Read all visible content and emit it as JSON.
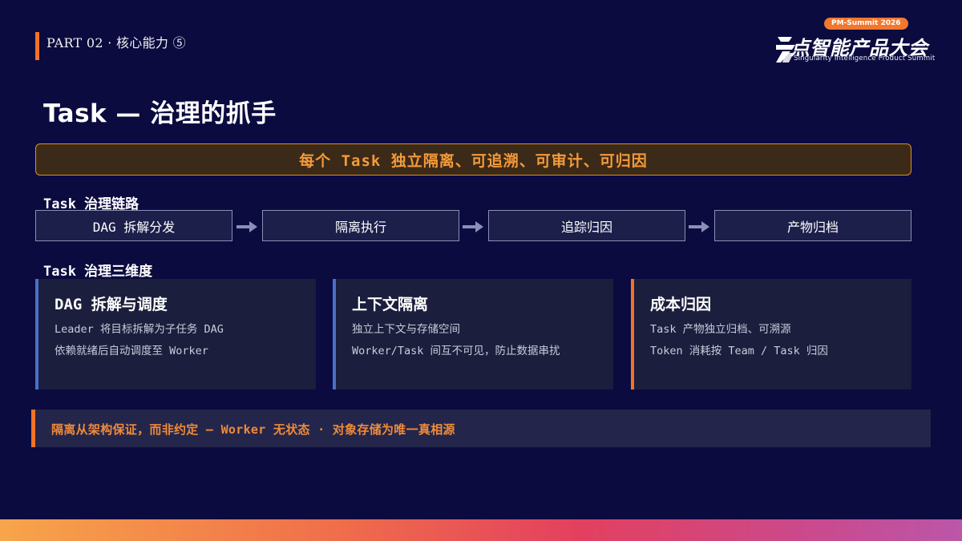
{
  "header": {
    "part_label": "PART 02 · 核心能力 ⑤"
  },
  "logo": {
    "badge": "PM-Summit 2026",
    "title": "点智能产品大会",
    "subtitle": "Singularity Intelligence Product Summit"
  },
  "title": "Task — 治理的抓手",
  "banner": "每个 Task 独立隔离、可追溯、可审计、可归因",
  "chain": {
    "label": "Task 治理链路",
    "steps": [
      "DAG 拆解分发",
      "隔离执行",
      "追踪归因",
      "产物归档"
    ]
  },
  "dimensions": {
    "label": "Task 治理三维度",
    "cards": [
      {
        "title": "DAG 拆解与调度",
        "lines": [
          "Leader 将目标拆解为子任务 DAG",
          "依赖就绪后自动调度至 Worker"
        ],
        "accent": "#4a6fc9"
      },
      {
        "title": "上下文隔离",
        "lines": [
          "独立上下文与存储空间",
          "Worker/Task 间互不可见，防止数据串扰"
        ],
        "accent": "#4a6fc9"
      },
      {
        "title": "成本归因",
        "lines": [
          "Task 产物独立归档、可溯源",
          "Token 消耗按 Team / Task 归因"
        ],
        "accent": "#f27226"
      }
    ]
  },
  "note": "隔离从架构保证，而非约定 — Worker 无状态 · 对象存储为唯一真相源",
  "colors": {
    "background": "#0b0b3f",
    "accent_orange": "#f27226",
    "accent_blue": "#4a6fc9"
  }
}
